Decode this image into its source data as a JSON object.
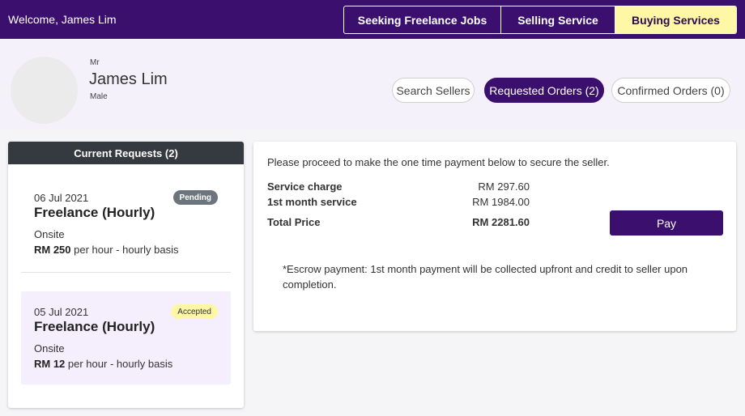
{
  "header": {
    "welcome": "Welcome, James Lim",
    "nav": [
      "Seeking Freelance Jobs",
      "Selling Service",
      "Buying Services"
    ]
  },
  "profile": {
    "salutation": "Mr",
    "name": "James Lim",
    "gender": "Male"
  },
  "pills": {
    "search": "Search Sellers",
    "requested": "Requested Orders (2)",
    "confirmed": "Confirmed Orders (0)"
  },
  "requests": {
    "title": "Current Requests (2)",
    "items": [
      {
        "date": "06 Jul 2021",
        "title": "Freelance (Hourly)",
        "location": "Onsite",
        "amount": "RM 250",
        "rate_suffix": " per hour - hourly basis",
        "status": "Pending"
      },
      {
        "date": "05 Jul 2021",
        "title": "Freelance (Hourly)",
        "location": "Onsite",
        "amount": "RM 12",
        "rate_suffix": " per hour - hourly basis",
        "status": "Accepted"
      }
    ]
  },
  "payment": {
    "intro": "Please proceed to make the one time payment below to secure the seller.",
    "lines": [
      {
        "label": "Service charge",
        "value": "RM 297.60"
      },
      {
        "label": "1st month service",
        "value": "RM 1984.00"
      },
      {
        "label": "Total Price",
        "value": "RM 2281.60"
      }
    ],
    "pay_label": "Pay",
    "escrow_note": "*Escrow payment: 1st month payment will be collected upfront and credit to seller upon completion."
  },
  "colors": {
    "brand": "#3b0f6e",
    "highlight": "#fdf7a6",
    "pending": "#6c757d",
    "accepted_bg": "#f5eefc"
  }
}
